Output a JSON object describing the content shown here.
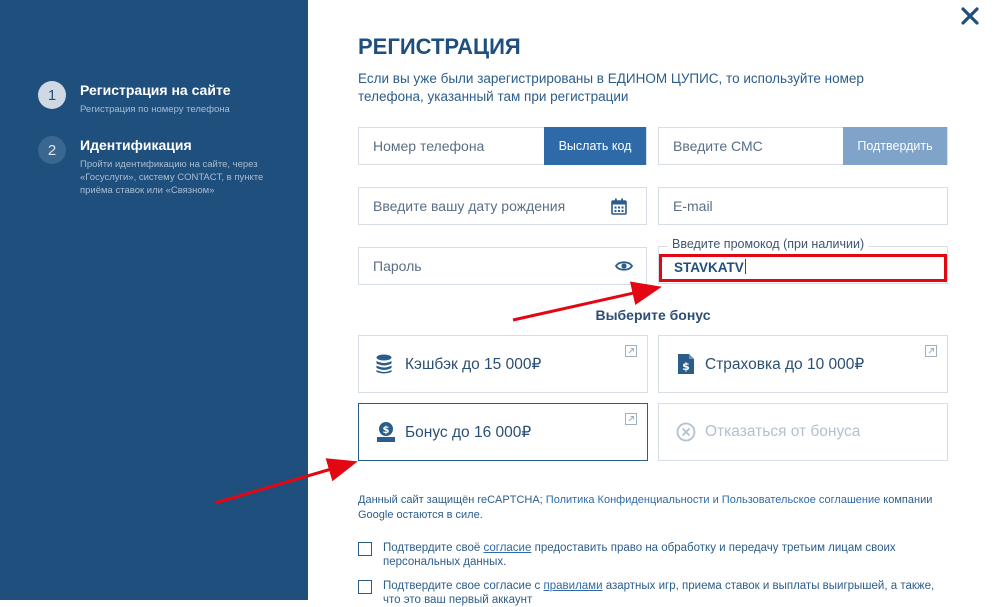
{
  "sidebar": {
    "steps": [
      {
        "number": "1",
        "title": "Регистрация на сайте",
        "subtitle": "Регистрация по номеру телефона"
      },
      {
        "number": "2",
        "title": "Идентификация",
        "subtitle": "Пройти идентификацию на сайте, через «Госуслуги», систему CONTACT, в пункте приёма ставок или «Связном»"
      }
    ]
  },
  "dialog": {
    "close_icon": "close-icon",
    "title": "РЕГИСТРАЦИЯ",
    "intro": "Если вы уже были зарегистрированы в ЕДИНОМ ЦУПИС, то используйте номер телефона, указанный там при регистрации"
  },
  "form": {
    "phone_placeholder": "Номер телефона",
    "send_code_label": "Выслать код",
    "sms_placeholder": "Введите СМС",
    "confirm_label": "Подтвердить",
    "birthdate_placeholder": "Введите вашу дату рождения",
    "email_placeholder": "E-mail",
    "password_placeholder": "Пароль",
    "promo_label": "Введите промокод (при наличии)",
    "promo_value": "STAVKATV"
  },
  "bonus": {
    "heading": "Выберите бонус",
    "options": [
      {
        "label": "Кэшбэк до 15 000₽",
        "icon": "coins-icon"
      },
      {
        "label": "Страховка до 10 000₽",
        "icon": "document-dollar-icon"
      },
      {
        "label": "Бонус до 16 000₽",
        "icon": "bonus-icon"
      },
      {
        "label": "Отказаться от бонуса",
        "icon": "cancel-circle-icon"
      }
    ]
  },
  "legal": {
    "recaptcha_text": "Данный сайт защищён reCAPTCHA; ",
    "recaptcha_links": "Политика Конфиденциальности и Пользовательское соглашение",
    "recaptcha_tail": " компании Google остаются в силе."
  },
  "consents": [
    {
      "pre": "Подтвердите своё ",
      "link": "согласие",
      "post": " предоставить право на обработку и передачу третьим лицам своих персональных данных."
    },
    {
      "pre": "Подтвердите свое согласие с ",
      "link": "правилами",
      "post": " азартных игр, приема ставок и выплаты выигрышей, а также, что это ваш первый аккаунт"
    }
  ],
  "colors": {
    "sidebar": "#1f4f7d",
    "primary": "#2f6aa8",
    "highlight": "#e30613"
  }
}
